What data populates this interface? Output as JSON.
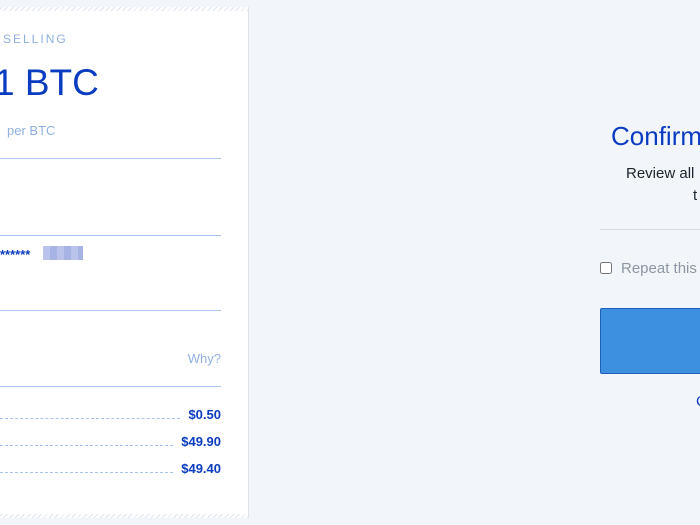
{
  "summary": {
    "heading": "SELLING",
    "amount": "1 BTC",
    "rate_suffix": "per BTC",
    "masked_account": "******",
    "why_link": "Why?",
    "line_items": [
      {
        "value": "$0.50"
      },
      {
        "value": "$49.90"
      },
      {
        "value": "$49.40"
      }
    ]
  },
  "confirm": {
    "title": "Confirm",
    "subtitle_line1": "Review all",
    "subtitle_line2": "t",
    "repeat_label": "Repeat this",
    "repeat_checked": false,
    "footer_link": "C"
  },
  "colors": {
    "accent": "#0a3cc2",
    "button": "#3d8fdf",
    "background": "#f2f5f9"
  }
}
